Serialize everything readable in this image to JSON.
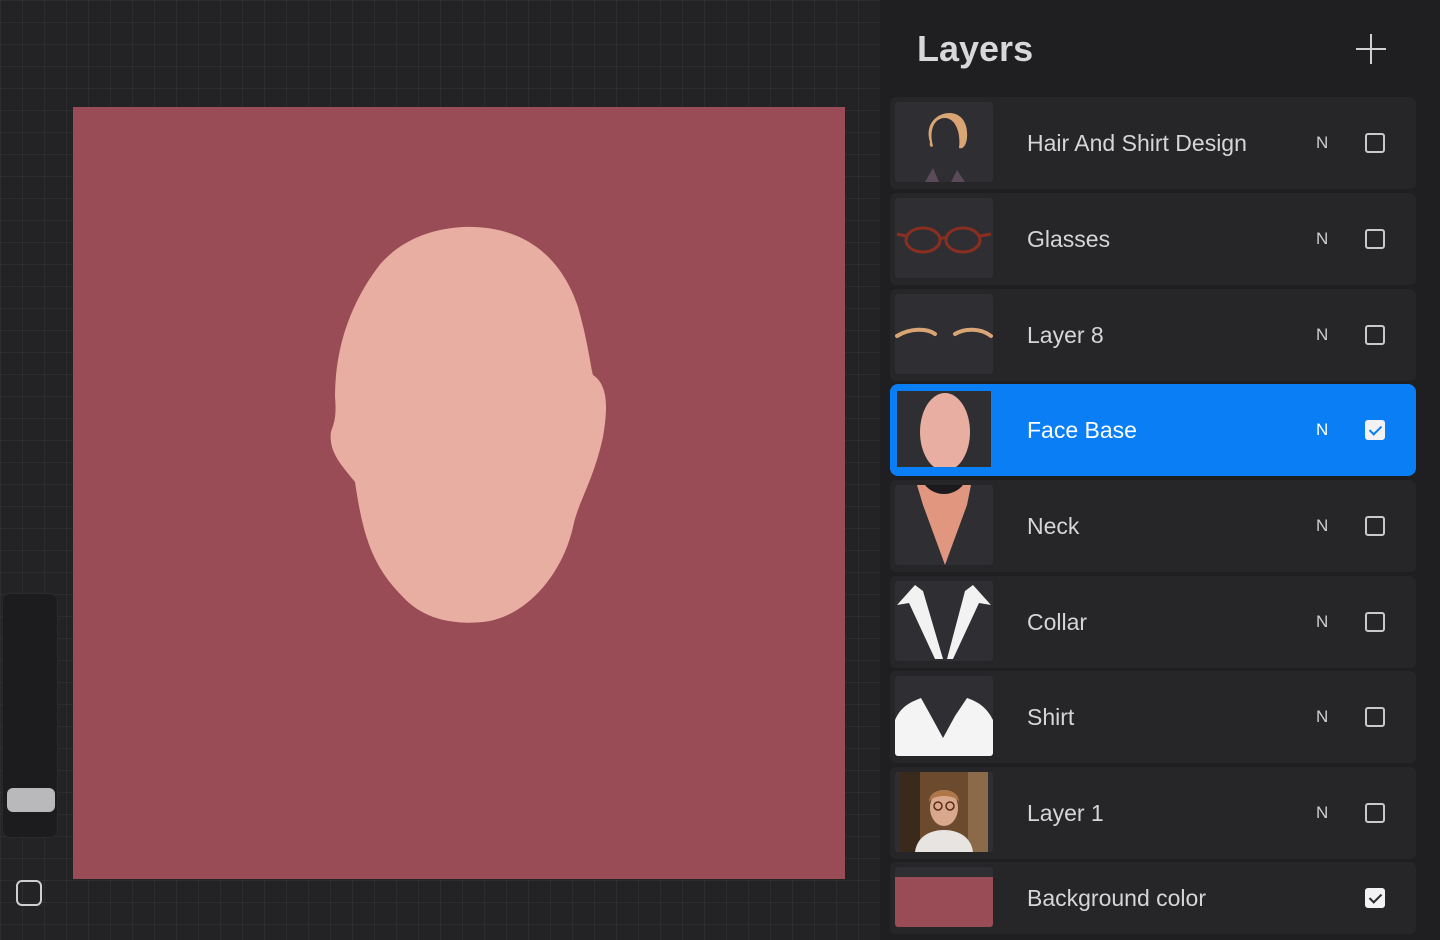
{
  "panel": {
    "title": "Layers",
    "add_icon": "plus-icon"
  },
  "canvas": {
    "background_color": "#994c55",
    "face_color": "#e8aea1"
  },
  "layers": [
    {
      "name": "Hair And Shirt Design",
      "mode": "N",
      "visible": false,
      "thumbnail": "hair-thumbnail-icon"
    },
    {
      "name": "Glasses",
      "mode": "N",
      "visible": false,
      "thumbnail": "glasses-thumbnail-icon"
    },
    {
      "name": "Layer 8",
      "mode": "N",
      "visible": false,
      "thumbnail": "eyebrows-thumbnail-icon"
    },
    {
      "name": "Face Base",
      "mode": "N",
      "visible": true,
      "selected": true,
      "thumbnail": "face-thumbnail-icon"
    },
    {
      "name": "Neck",
      "mode": "N",
      "visible": false,
      "thumbnail": "neck-thumbnail-icon"
    },
    {
      "name": "Collar",
      "mode": "N",
      "visible": false,
      "thumbnail": "collar-thumbnail-icon"
    },
    {
      "name": "Shirt",
      "mode": "N",
      "visible": false,
      "thumbnail": "shirt-thumbnail-icon"
    },
    {
      "name": "Layer 1",
      "mode": "N",
      "visible": false,
      "thumbnail": "photo-thumbnail-icon"
    },
    {
      "name": "Background color",
      "mode": "",
      "visible": true,
      "thumbnail": "background-color-swatch"
    }
  ],
  "colors": {
    "accent": "#0a7ff5",
    "panel_bg": "#1f1f21",
    "row_bg": "#262628"
  }
}
